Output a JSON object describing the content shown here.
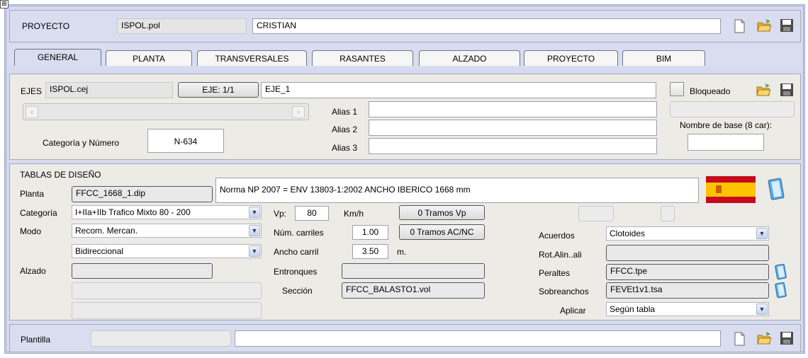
{
  "proyecto": {
    "label": "PROYECTO",
    "file": "ISPOL.pol",
    "author": "CRISTIAN"
  },
  "tabs": [
    {
      "label": "GENERAL",
      "active": true
    },
    {
      "label": "PLANTA"
    },
    {
      "label": "TRANSVERSALES"
    },
    {
      "label": "RASANTES"
    },
    {
      "label": "ALZADO"
    },
    {
      "label": "PROYECTO"
    },
    {
      "label": "BIM"
    }
  ],
  "ejes": {
    "label": "EJES",
    "file": "ISPOL.cej",
    "eje_button": "EJE: 1/1",
    "eje_name": "EJE_1",
    "bloqueado_label": "Bloqueado",
    "alias1_label": "Alias 1",
    "alias2_label": "Alias 2",
    "alias3_label": "Alias 3",
    "alias1": "",
    "alias2": "",
    "alias3": "",
    "categoria_label": "Categoría y Número",
    "categoria_value": "N-634",
    "nombre_base_label": "Nombre de base (8 car):",
    "nombre_base_value": ""
  },
  "tablas": {
    "title": "TABLAS DE DISEÑO",
    "planta_label": "Planta",
    "planta_file": "FFCC_1668_1.dip",
    "norma": "Norma NP 2007 = ENV 13803-1:2002 ANCHO IBERICO 1668 mm",
    "categoria_label": "Categoría",
    "categoria_value": "I+IIa+IIb  Trafico Mixto 80 - 200",
    "modo_label": "Modo",
    "modo_value": "Recom. Mercan.",
    "direccion_value": "Bidireccional",
    "alzado_label": "Alzado",
    "alzado_value": "",
    "vp_label": "Vp:",
    "vp_value": "80",
    "vp_unit": "Km/h",
    "tramos_vp": "0 Tramos Vp",
    "carriles_label": "Núm. carriles",
    "carriles_value": "1.00",
    "tramos_acnc": "0 Tramos AC/NC",
    "ancho_label": "Ancho carril",
    "ancho_value": "3.50",
    "ancho_unit": "m.",
    "entronques_label": "Entronques",
    "entronques_value": "",
    "seccion_label": "Sección",
    "seccion_value": "FFCC_BALASTO1.vol",
    "acuerdos_label": "Acuerdos",
    "acuerdos_value": "Clotoides",
    "rot_label": "Rot.Alin..ali",
    "rot_value": "",
    "peraltes_label": "Peraltes",
    "peraltes_value": "FFCC.tpe",
    "sobreanchos_label": "Sobreanchos",
    "sobreanchos_value": "FEVEt1v1.tsa",
    "aplicar_label": "Aplicar",
    "aplicar_value": "Según tabla"
  },
  "plantilla": {
    "label": "Plantilla",
    "value": "",
    "path": ""
  },
  "colors": {
    "frame": "#9ba6c9",
    "panel": "#ecebe6",
    "tab_bg": "#d9ddef",
    "flag_red": "#c60b1e",
    "flag_yellow": "#ffc400"
  }
}
